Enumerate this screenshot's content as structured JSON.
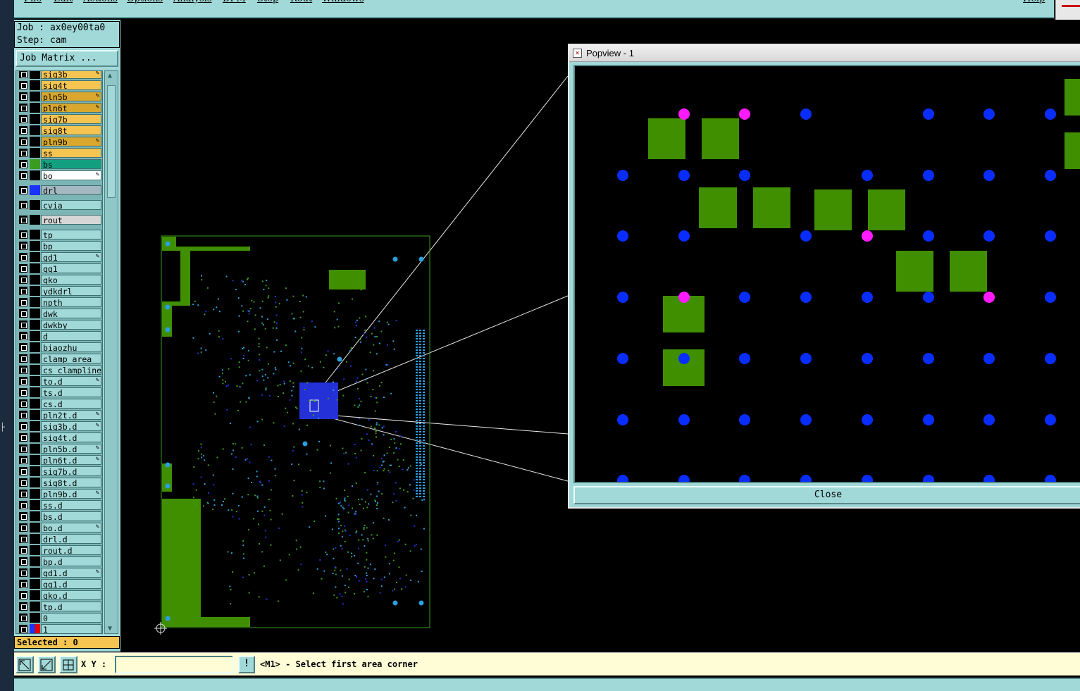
{
  "menu": {
    "items": [
      "File",
      "Edit",
      "Actions",
      "Options",
      "Analysis",
      "DFM",
      "Step",
      "Rout",
      "Windows",
      "Help"
    ]
  },
  "job": {
    "job_line": "Job : ax0ey00ta0",
    "step_line": "Step: cam",
    "matrix_button": "Job Matrix ..."
  },
  "layers": [
    {
      "name": "sig3b",
      "color": "#f5c451",
      "swatch": "#000000",
      "mark": true,
      "partial": true
    },
    {
      "name": "sig4t",
      "color": "#f5c451",
      "swatch": "#000000",
      "mark": false
    },
    {
      "name": "pln5b",
      "color": "#d9a72e",
      "swatch": "#000000",
      "mark": true
    },
    {
      "name": "pln6t",
      "color": "#d9a72e",
      "swatch": "#000000",
      "mark": true
    },
    {
      "name": "sig7b",
      "color": "#f5c451",
      "swatch": "#000000",
      "mark": false
    },
    {
      "name": "sig8t",
      "color": "#f5c451",
      "swatch": "#000000",
      "mark": false
    },
    {
      "name": "pln9b",
      "color": "#d9a72e",
      "swatch": "#000000",
      "mark": true
    },
    {
      "name": "ss",
      "color": "#f5c451",
      "swatch": "#000000",
      "mark": false
    },
    {
      "name": "bs",
      "color": "#13a080",
      "swatch": "#3a9d20",
      "mark": false
    },
    {
      "name": "bo",
      "color": "#ffffff",
      "swatch": "#000000",
      "mark": true
    },
    {
      "name": "drl",
      "color": "#a3b8c0",
      "swatch": "#1a33ff",
      "mark": false,
      "gap": true
    },
    {
      "name": "cvia",
      "color": "#a1d8d8",
      "swatch": "#000000",
      "mark": false,
      "gap": true
    },
    {
      "name": "rout",
      "color": "#d6d6d6",
      "swatch": "#000000",
      "mark": false,
      "gap": true
    },
    {
      "name": "tp",
      "color": "#a1d8d8",
      "swatch": "#000000",
      "mark": false,
      "gap": true
    },
    {
      "name": "bp",
      "color": "#a1d8d8",
      "swatch": "#000000",
      "mark": false
    },
    {
      "name": "gd1",
      "color": "#a1d8d8",
      "swatch": "#000000",
      "mark": true
    },
    {
      "name": "gg1",
      "color": "#a1d8d8",
      "swatch": "#000000",
      "mark": false
    },
    {
      "name": "gko",
      "color": "#a1d8d8",
      "swatch": "#000000",
      "mark": false
    },
    {
      "name": "ydkdrl",
      "color": "#a1d8d8",
      "swatch": "#000000",
      "mark": false
    },
    {
      "name": "npth",
      "color": "#a1d8d8",
      "swatch": "#000000",
      "mark": false
    },
    {
      "name": "dwk",
      "color": "#a1d8d8",
      "swatch": "#000000",
      "mark": false
    },
    {
      "name": "dwkby",
      "color": "#a1d8d8",
      "swatch": "#000000",
      "mark": false
    },
    {
      "name": "d",
      "color": "#a1d8d8",
      "swatch": "#000000",
      "mark": false
    },
    {
      "name": "biaozhu",
      "color": "#a1d8d8",
      "swatch": "#000000",
      "mark": false
    },
    {
      "name": "clamp_area",
      "color": "#a1d8d8",
      "swatch": "#000000",
      "mark": false
    },
    {
      "name": "cs_clampline",
      "color": "#a1d8d8",
      "swatch": "#000000",
      "mark": false
    },
    {
      "name": "to.d",
      "color": "#a1d8d8",
      "swatch": "#000000",
      "mark": true
    },
    {
      "name": "ts.d",
      "color": "#a1d8d8",
      "swatch": "#000000",
      "mark": false
    },
    {
      "name": "cs.d",
      "color": "#a1d8d8",
      "swatch": "#000000",
      "mark": false
    },
    {
      "name": "pln2t.d",
      "color": "#a1d8d8",
      "swatch": "#000000",
      "mark": true
    },
    {
      "name": "sig3b.d",
      "color": "#a1d8d8",
      "swatch": "#000000",
      "mark": true
    },
    {
      "name": "sig4t.d",
      "color": "#a1d8d8",
      "swatch": "#000000",
      "mark": false
    },
    {
      "name": "pln5b.d",
      "color": "#a1d8d8",
      "swatch": "#000000",
      "mark": true
    },
    {
      "name": "pln6t.d",
      "color": "#a1d8d8",
      "swatch": "#000000",
      "mark": true
    },
    {
      "name": "sig7b.d",
      "color": "#a1d8d8",
      "swatch": "#000000",
      "mark": false
    },
    {
      "name": "sig8t.d",
      "color": "#a1d8d8",
      "swatch": "#000000",
      "mark": false
    },
    {
      "name": "pln9b.d",
      "color": "#a1d8d8",
      "swatch": "#000000",
      "mark": true
    },
    {
      "name": "ss.d",
      "color": "#a1d8d8",
      "swatch": "#000000",
      "mark": false
    },
    {
      "name": "bs.d",
      "color": "#a1d8d8",
      "swatch": "#000000",
      "mark": false
    },
    {
      "name": "bo.d",
      "color": "#a1d8d8",
      "swatch": "#000000",
      "mark": true
    },
    {
      "name": "drl.d",
      "color": "#a1d8d8",
      "swatch": "#000000",
      "mark": false
    },
    {
      "name": "rout.d",
      "color": "#a1d8d8",
      "swatch": "#000000",
      "mark": false
    },
    {
      "name": "bp.d",
      "color": "#a1d8d8",
      "swatch": "#000000",
      "mark": false
    },
    {
      "name": "gd1.d",
      "color": "#a1d8d8",
      "swatch": "#000000",
      "mark": true
    },
    {
      "name": "gg1.d",
      "color": "#a1d8d8",
      "swatch": "#000000",
      "mark": false
    },
    {
      "name": "gko.d",
      "color": "#a1d8d8",
      "swatch": "#000000",
      "mark": false
    },
    {
      "name": "tp.d",
      "color": "#a1d8d8",
      "swatch": "#000000",
      "mark": false
    },
    {
      "name": "0",
      "color": "#a1d8d8",
      "swatch": "#000000",
      "mark": false
    },
    {
      "name": "1",
      "color": "#a1d8d8",
      "swatch": "#e60000",
      "mark": false,
      "cursor": true
    }
  ],
  "selected_text": "Selected : 0",
  "popview": {
    "title": "Popview - 1",
    "close_label": "Close"
  },
  "bottom": {
    "xy_label": "X Y :",
    "xy_value": "",
    "warn_label": "!",
    "prompt": "<M1> - Select first area corner"
  },
  "colors": {
    "panel": "#a1d8d8",
    "pad_green": "#3f8f00",
    "via_blue": "#0a2dff",
    "via_magenta": "#ff1aff",
    "board_outline": "#3a9d20"
  }
}
